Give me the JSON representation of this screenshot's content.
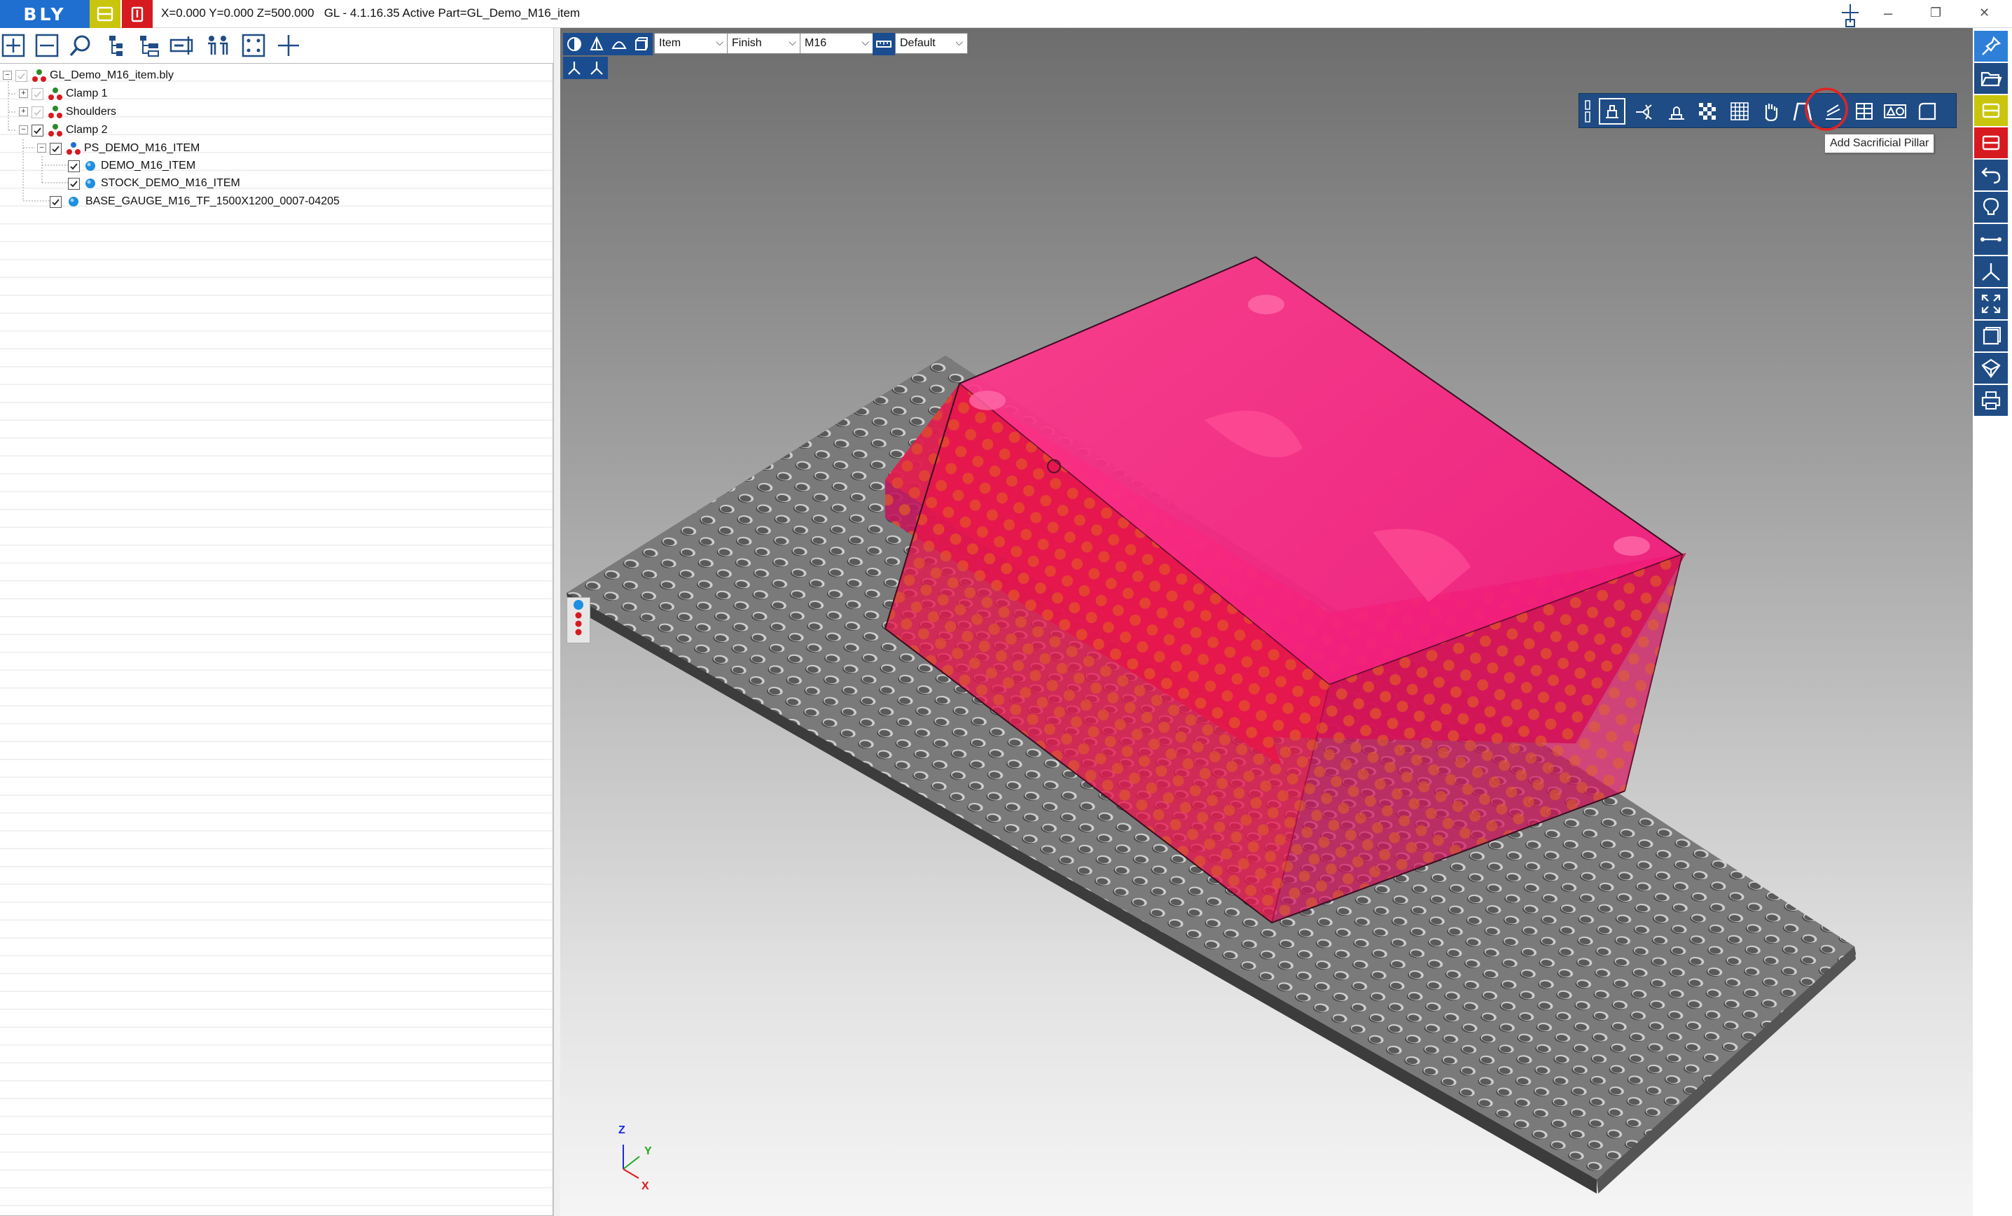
{
  "app": {
    "logo": "BLY",
    "window_title": "X=0.000 Y=0.000 Z=500.000   GL - 4.1.16.35 Active Part=GL_Demo_M16_item",
    "minimize": "–",
    "restore": "❐",
    "close": "✕"
  },
  "left_toolbar": {
    "icons": [
      "add-icon",
      "remove-icon",
      "search-icon",
      "tree-expand-icon",
      "tree-collapse-icon",
      "rename-icon",
      "assembly-icon",
      "grid-select-icon",
      "crosshair-icon"
    ]
  },
  "tree": {
    "items": [
      {
        "label": "GL_Demo_M16_item.bly"
      },
      {
        "label": "Clamp 1"
      },
      {
        "label": "Shoulders"
      },
      {
        "label": "Clamp 2"
      },
      {
        "label": "PS_DEMO_M16_ITEM"
      },
      {
        "label": "DEMO_M16_ITEM"
      },
      {
        "label": "STOCK_DEMO_M16_ITEM"
      },
      {
        "label": "BASE_GAUGE_M16_TF_1500X1200_0007-04205"
      }
    ]
  },
  "viewport_toolbar": {
    "dropdowns": {
      "mode": "Item",
      "finish": "Finish",
      "size": "M16",
      "view": "Default"
    }
  },
  "floating_toolbar": {
    "tooltip": "Add Sacrificial Pillar",
    "highlight_color": "#e02424"
  },
  "axes": {
    "z": "Z",
    "y": "Y",
    "x": "X"
  },
  "colors": {
    "brand_blue": "#1e6fd0",
    "toolbar_blue": "#1f4c84",
    "accent_yellow": "#c9c40c",
    "accent_red": "#d71920",
    "part_magenta": "#ff1a7a"
  }
}
